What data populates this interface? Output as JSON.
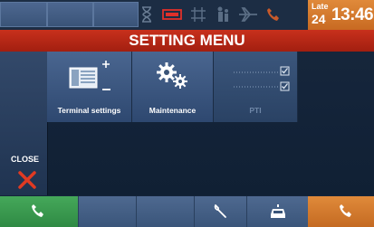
{
  "status": {
    "late_label": "Late",
    "late_value": "24",
    "clock": "13:46"
  },
  "title": "SETTING MENU",
  "menu": {
    "items": [
      {
        "label": "Terminal settings",
        "enabled": true
      },
      {
        "label": "Maintenance",
        "enabled": true
      },
      {
        "label": "PTI",
        "enabled": false
      }
    ]
  },
  "close": {
    "label": "CLOSE"
  },
  "colors": {
    "accent_red": "#c8301c",
    "call_green": "#3a9a4e",
    "call_orange": "#d47a2e",
    "tile_blue": "#3c5880"
  },
  "icons": [
    "phone-icon",
    "wrench-icon",
    "car-icon",
    "gear-icon",
    "close-icon",
    "checkbox-icon"
  ]
}
